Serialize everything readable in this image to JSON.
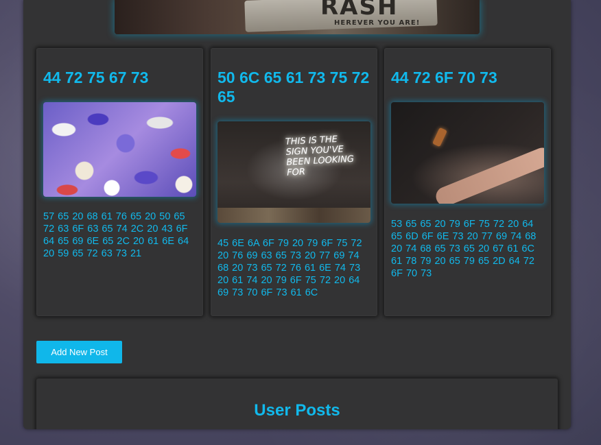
{
  "hero": {
    "sign_text": "RASH",
    "sign_subtext": "HEREVER YOU ARE!"
  },
  "cards": [
    {
      "title": "44 72 75 67 73",
      "image_icon": "pills-image",
      "text": "57 65 20 68 61 76 65 20 50 65 72 63 6F 63 65 74 2C 20 43 6F 64 65 69 6E 65 2C 20 61 6E 64 20 59 65 72 63 73 21"
    },
    {
      "title": "50 6C 65 61 73 75 72 65",
      "image_icon": "neon-sign-image",
      "image_text": "THIS IS THE SIGN YOU'VE BEEN LOOKING FOR",
      "text": "45 6E 6A 6F 79 20 79 6F 75 72 20 76 69 63 65 73 20 77 69 74 68 20 73 65 72 76 61 6E 74 73 20 61 74 20 79 6F 75 72 20 64 69 73 70 6F 73 61 6C"
    },
    {
      "title": "44 72 6F 70 73",
      "image_icon": "hand-bottle-image",
      "text": "53 65 65 20 79 6F 75 72 20 64 65 6D 6F 6E 73 20 77 69 74 68 20 74 68 65 73 65 20 67 61 6C 61 78 79 20 65 79 65 2D 64 72 6F 70 73"
    }
  ],
  "actions": {
    "add_post_label": "Add New Post"
  },
  "user_posts": {
    "title": "User Posts"
  },
  "colors": {
    "accent": "#10b7ea",
    "panel": "#333334"
  }
}
